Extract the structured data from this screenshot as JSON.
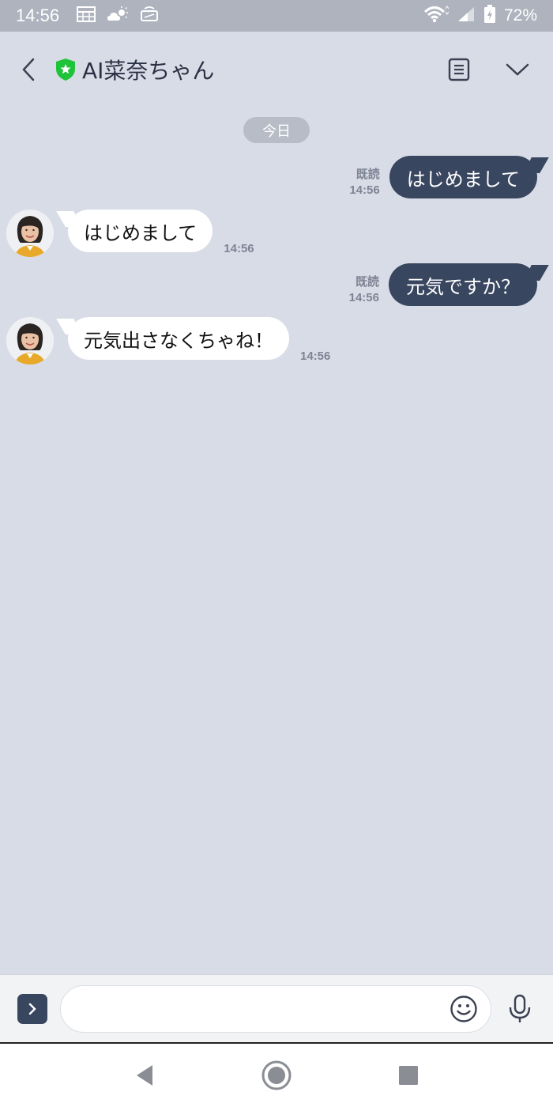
{
  "status_bar": {
    "time": "14:56",
    "battery_percent": "72%",
    "left_icons": [
      "calendar-icon",
      "weather-icon",
      "cast-icon"
    ],
    "right_icons": [
      "wifi-icon",
      "signal-icon",
      "battery-icon"
    ]
  },
  "header": {
    "title": "AI菜奈ちゃん",
    "badge_icon": "verified-shield-icon",
    "accent_color": "#1fc33a"
  },
  "chat": {
    "date_label": "今日",
    "messages": [
      {
        "side": "out",
        "text": "はじめまして",
        "read_label": "既読",
        "time": "14:56"
      },
      {
        "side": "in",
        "text": "はじめまして",
        "time": "14:56"
      },
      {
        "side": "out",
        "text": "元気ですか？",
        "read_label": "既読",
        "time": "14:56"
      },
      {
        "side": "in",
        "text": "元気出さなくちゃね！",
        "time": "14:56"
      }
    ]
  },
  "input": {
    "placeholder": "",
    "value": ""
  },
  "colors": {
    "background": "#d8dce6",
    "outgoing_bubble": "#394660",
    "incoming_bubble": "#ffffff",
    "status_bar": "#aeb3be"
  }
}
